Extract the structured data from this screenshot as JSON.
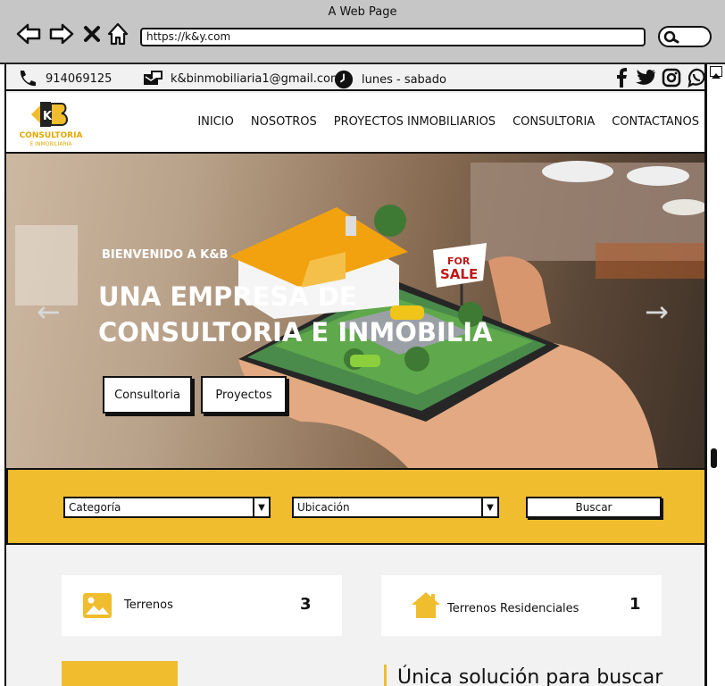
{
  "browser": {
    "title": "A Web Page",
    "url": "https://k&y.com"
  },
  "infobar": {
    "phone": "914069125",
    "email": "k&binmobiliaria1@gmail.com",
    "hours": "lunes - sabado",
    "social_icons": [
      "facebook-icon",
      "twitter-icon",
      "instagram-icon",
      "whatsapp-icon"
    ]
  },
  "logo": {
    "mark": "K&B",
    "line1": "CONSULTORIA",
    "line2": "E INMOBILIARIA"
  },
  "menu": [
    "INICIO",
    "NOSOTROS",
    "PROYECTOS INMOBILIARIOS",
    "CONSULTORIA",
    "CONTACTANOS"
  ],
  "hero": {
    "welcome": "BIENVENIDO A K&B",
    "headline_line1": "UNA EMPRESA DE",
    "headline_line2": "CONSULTORIA E INMOBILIA",
    "sign_line1": "FOR",
    "sign_line2": "SALE",
    "button1": "Consultoria",
    "button2": "Proyectos"
  },
  "search": {
    "category": "Categoría",
    "location": "Ubicación",
    "button": "Buscar"
  },
  "stats": [
    {
      "label": "Terrenos",
      "count": "3",
      "icon": "image-icon"
    },
    {
      "label": "Terrenos Residenciales",
      "count": "1",
      "icon": "house-icon"
    }
  ],
  "section": {
    "heading": "Única solución para buscar"
  },
  "colors": {
    "accent": "#efbd2e",
    "chrome": "#c6c6c6"
  }
}
